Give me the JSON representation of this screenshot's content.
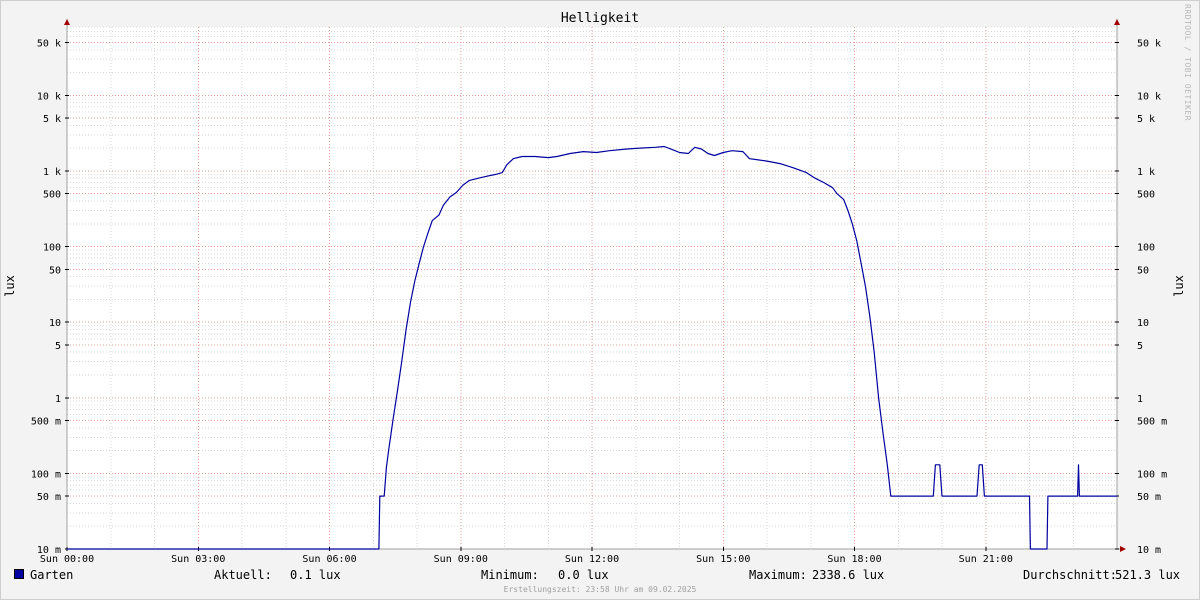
{
  "colors": {
    "background": "#f3f3f3",
    "plot_background": "#ffffff",
    "major_grid": "#e6a0a0",
    "minor_grid": "#d8d8d8",
    "axis": "#a0a0a0",
    "arrow": "#a00000",
    "series": "#0000a0"
  },
  "watermark": "RRDTOOL / TOBI OETIKER",
  "legend": {
    "series_name": "Garten",
    "current_label": "Aktuell:",
    "current_value": "0.1 lux",
    "min_label": "Minimum:",
    "min_value": "0.0 lux",
    "max_label": "Maximum:",
    "max_value": "2338.6 lux",
    "avg_label": "Durchschnitt:",
    "avg_value": "521.3 lux"
  },
  "footer": "Erstellungszeit: 23:58 Uhr am 09.02.2025",
  "chart_data": {
    "type": "line",
    "title": "Helligkeit",
    "ylabel": "lux",
    "ylabel_right": "lux",
    "yscale": "log",
    "ylim": [
      0.01,
      80000
    ],
    "xlim": [
      0,
      24
    ],
    "x_ticks": [
      {
        "x": 0,
        "label": "Sun 00:00"
      },
      {
        "x": 3,
        "label": "Sun 03:00"
      },
      {
        "x": 6,
        "label": "Sun 06:00"
      },
      {
        "x": 9,
        "label": "Sun 09:00"
      },
      {
        "x": 12,
        "label": "Sun 12:00"
      },
      {
        "x": 15,
        "label": "Sun 15:00"
      },
      {
        "x": 18,
        "label": "Sun 18:00"
      },
      {
        "x": 21,
        "label": "Sun 21:00"
      }
    ],
    "y_ticks": [
      {
        "v": 50000,
        "label": "50 k"
      },
      {
        "v": 10000,
        "label": "10 k"
      },
      {
        "v": 5000,
        "label": "5 k"
      },
      {
        "v": 1000,
        "label": "1 k"
      },
      {
        "v": 500,
        "label": "500"
      },
      {
        "v": 100,
        "label": "100"
      },
      {
        "v": 50,
        "label": "50"
      },
      {
        "v": 10,
        "label": "10"
      },
      {
        "v": 5,
        "label": "5"
      },
      {
        "v": 1,
        "label": "1"
      },
      {
        "v": 0.5,
        "label": "500 m"
      },
      {
        "v": 0.1,
        "label": "100 m"
      },
      {
        "v": 0.05,
        "label": "50 m"
      },
      {
        "v": 0.01,
        "label": "10 m"
      }
    ],
    "grid": true,
    "legend_position": "bottom",
    "series": [
      {
        "name": "Garten",
        "color": "#0000a0",
        "points": [
          [
            0.0,
            0.01
          ],
          [
            7.13,
            0.01
          ],
          [
            7.15,
            0.05
          ],
          [
            7.25,
            0.05
          ],
          [
            7.3,
            0.12
          ],
          [
            7.35,
            0.2
          ],
          [
            7.45,
            0.5
          ],
          [
            7.55,
            1.2
          ],
          [
            7.65,
            3
          ],
          [
            7.75,
            8
          ],
          [
            7.85,
            18
          ],
          [
            7.95,
            35
          ],
          [
            8.05,
            60
          ],
          [
            8.15,
            100
          ],
          [
            8.25,
            150
          ],
          [
            8.35,
            220
          ],
          [
            8.5,
            260
          ],
          [
            8.6,
            350
          ],
          [
            8.75,
            450
          ],
          [
            8.9,
            520
          ],
          [
            9.05,
            650
          ],
          [
            9.2,
            750
          ],
          [
            9.4,
            800
          ],
          [
            9.6,
            850
          ],
          [
            9.8,
            900
          ],
          [
            9.95,
            950
          ],
          [
            10.05,
            1200
          ],
          [
            10.2,
            1450
          ],
          [
            10.4,
            1550
          ],
          [
            10.7,
            1550
          ],
          [
            11.0,
            1500
          ],
          [
            11.2,
            1550
          ],
          [
            11.5,
            1700
          ],
          [
            11.8,
            1800
          ],
          [
            12.1,
            1750
          ],
          [
            12.4,
            1850
          ],
          [
            12.8,
            1950
          ],
          [
            13.1,
            2000
          ],
          [
            13.45,
            2050
          ],
          [
            13.65,
            2100
          ],
          [
            13.85,
            1900
          ],
          [
            14.0,
            1750
          ],
          [
            14.2,
            1700
          ],
          [
            14.35,
            2050
          ],
          [
            14.5,
            1950
          ],
          [
            14.65,
            1700
          ],
          [
            14.8,
            1600
          ],
          [
            15.0,
            1750
          ],
          [
            15.2,
            1850
          ],
          [
            15.45,
            1800
          ],
          [
            15.6,
            1450
          ],
          [
            15.8,
            1400
          ],
          [
            16.0,
            1350
          ],
          [
            16.3,
            1250
          ],
          [
            16.6,
            1100
          ],
          [
            16.9,
            950
          ],
          [
            17.1,
            800
          ],
          [
            17.3,
            700
          ],
          [
            17.5,
            600
          ],
          [
            17.6,
            500
          ],
          [
            17.75,
            420
          ],
          [
            17.85,
            300
          ],
          [
            17.95,
            200
          ],
          [
            18.05,
            120
          ],
          [
            18.15,
            60
          ],
          [
            18.25,
            30
          ],
          [
            18.35,
            12
          ],
          [
            18.45,
            4
          ],
          [
            18.55,
            1
          ],
          [
            18.65,
            0.35
          ],
          [
            18.75,
            0.13
          ],
          [
            18.83,
            0.05
          ],
          [
            19.8,
            0.05
          ],
          [
            19.85,
            0.13
          ],
          [
            19.95,
            0.13
          ],
          [
            20.0,
            0.05
          ],
          [
            20.8,
            0.05
          ],
          [
            20.85,
            0.13
          ],
          [
            20.92,
            0.13
          ],
          [
            20.97,
            0.05
          ],
          [
            22.0,
            0.05
          ],
          [
            22.02,
            0.01
          ],
          [
            22.4,
            0.01
          ],
          [
            22.42,
            0.05
          ],
          [
            23.1,
            0.05
          ],
          [
            23.12,
            0.13
          ],
          [
            23.14,
            0.05
          ],
          [
            24.0,
            0.05
          ]
        ]
      }
    ]
  }
}
